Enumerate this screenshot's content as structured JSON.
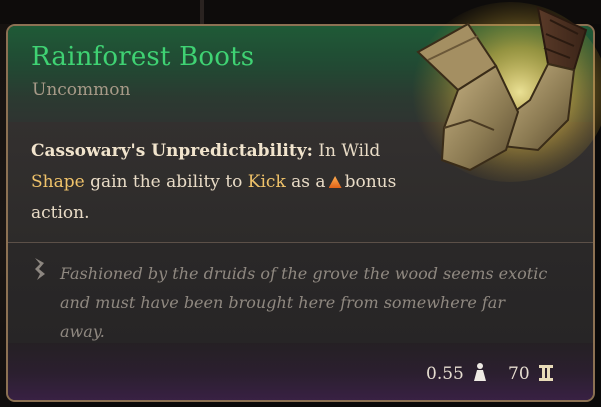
{
  "item": {
    "name": "Rainforest Boots",
    "rarity": "Uncommon",
    "colors": {
      "name": "#3fd273",
      "keyword": "#f0c36a",
      "border": "#8c7153"
    }
  },
  "passive": {
    "name": "Cassowary's Unpredictability:",
    "segments": [
      "In Wild",
      "Shape",
      "gain the ability to",
      "Kick",
      "as a",
      "bonus",
      "action."
    ],
    "action_icon": "bonus-action-triangle-icon"
  },
  "lore": {
    "icon": "quote-scroll-icon",
    "text": "Fashioned by the druids of the grove the wood seems exotic and must have been brought here from somewhere far away."
  },
  "footer": {
    "weight": "0.55",
    "weight_icon": "weight-icon",
    "value": "70",
    "value_icon": "gold-coin-icon"
  }
}
